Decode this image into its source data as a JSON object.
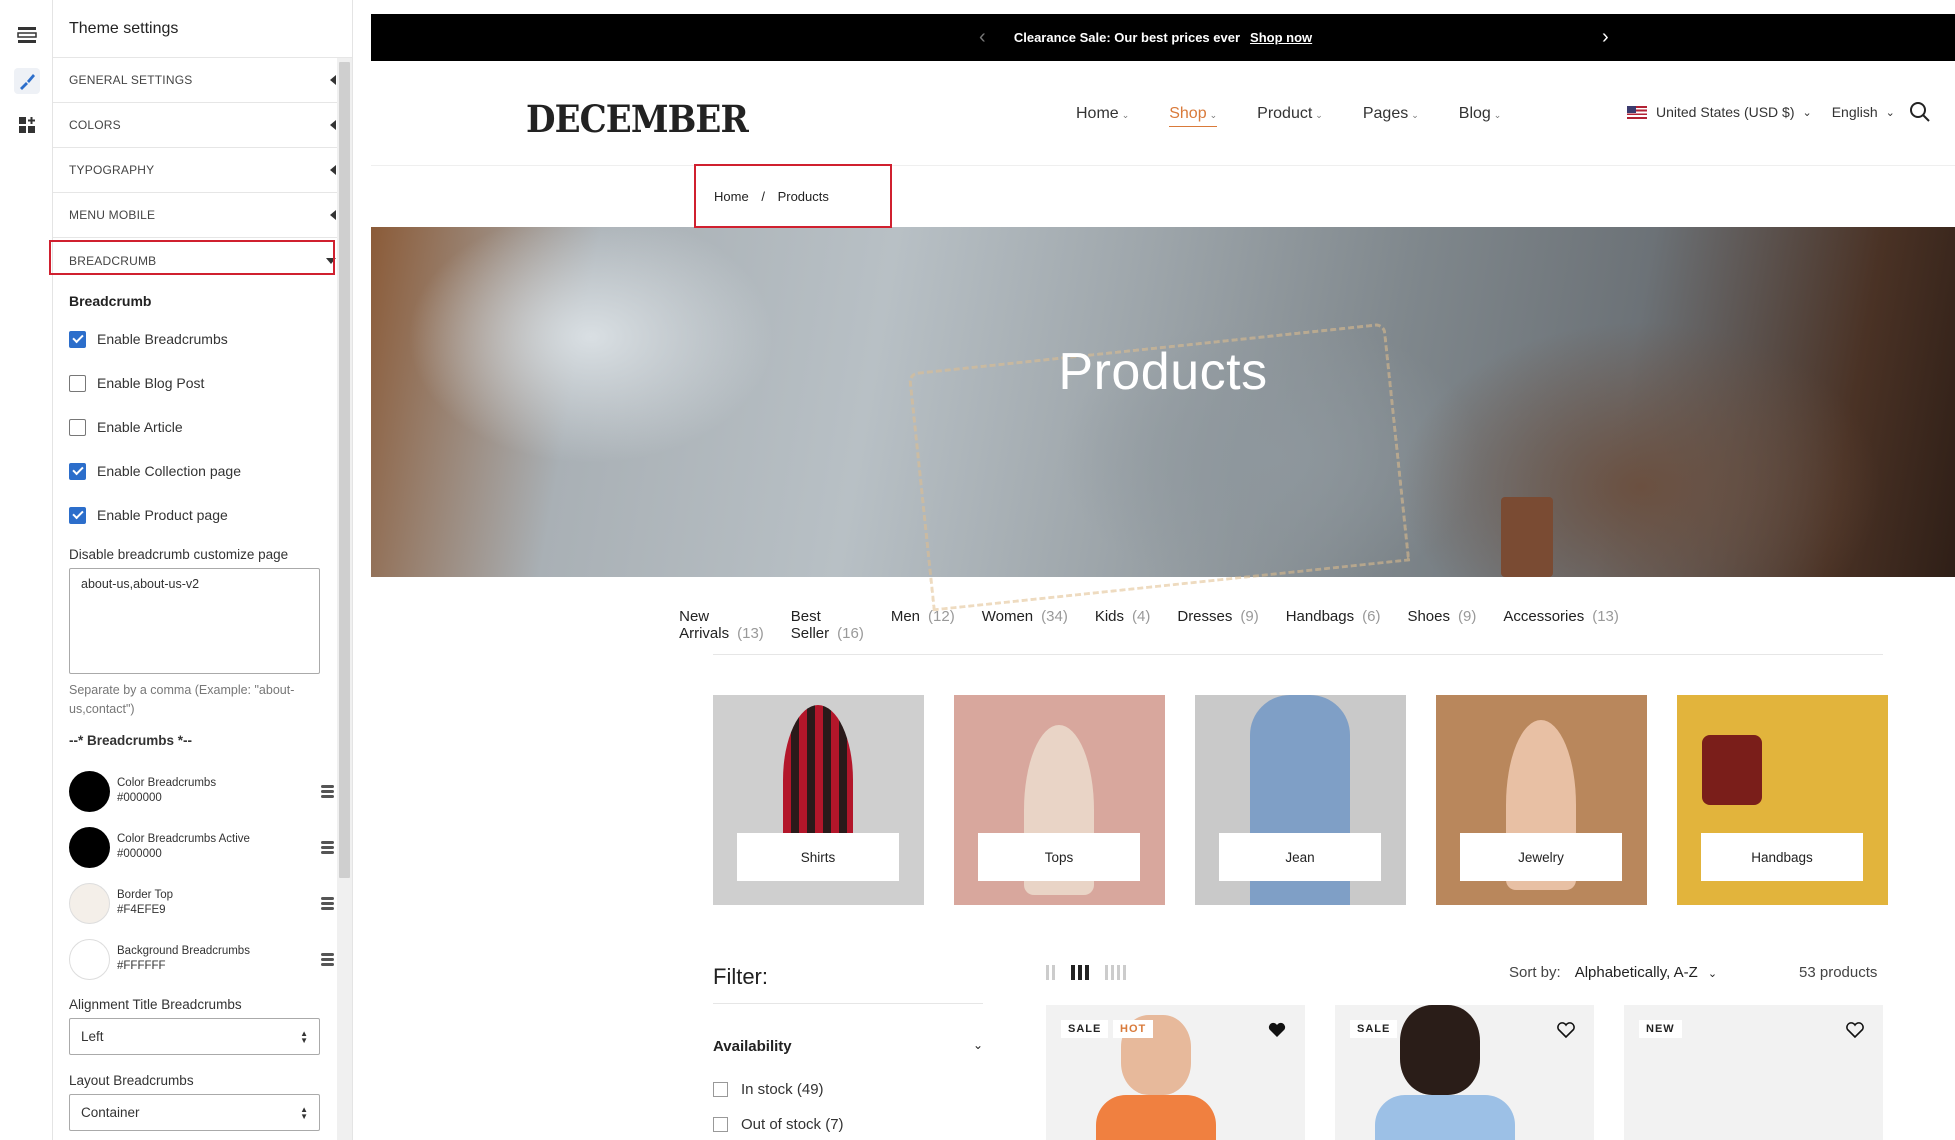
{
  "panel": {
    "title": "Theme settings",
    "sections": [
      "GENERAL SETTINGS",
      "COLORS",
      "TYPOGRAPHY",
      "MENU MOBILE",
      "BREADCRUMB"
    ],
    "subtitle": "Breadcrumb",
    "checkboxes": [
      {
        "label": "Enable Breadcrumbs",
        "checked": true
      },
      {
        "label": "Enable Blog Post",
        "checked": false
      },
      {
        "label": "Enable Article",
        "checked": false
      },
      {
        "label": "Enable Collection page",
        "checked": true
      },
      {
        "label": "Enable Product page",
        "checked": true
      }
    ],
    "disable_label": "Disable breadcrumb customize page",
    "disable_value": "about-us,about-us-v2",
    "help": "Separate by a comma (Example: \"about-us,contact\")",
    "group": "--* Breadcrumbs *--",
    "colors": [
      {
        "name": "Color Breadcrumbs",
        "hex": "#000000"
      },
      {
        "name": "Color Breadcrumbs Active",
        "hex": "#000000"
      },
      {
        "name": "Border Top",
        "hex": "#F4EFE9"
      },
      {
        "name": "Background Breadcrumbs",
        "hex": "#FFFFFF"
      }
    ],
    "align_label": "Alignment Title Breadcrumbs",
    "align_value": "Left",
    "layout_label": "Layout Breadcrumbs",
    "layout_value": "Container"
  },
  "site": {
    "announcement": "Clearance Sale: Our best prices ever",
    "announcement_link": "Shop now",
    "logo": "DECEMBER",
    "nav": [
      "Home",
      "Shop",
      "Product",
      "Pages",
      "Blog"
    ],
    "nav_active": "Shop",
    "currency": "United States (USD $)",
    "language": "English",
    "breadcrumb": {
      "home": "Home",
      "sep": "/",
      "current": "Products"
    },
    "hero_title": "Products",
    "categories": [
      {
        "name": "New Arrivals",
        "count": "(13)"
      },
      {
        "name": "Best Seller",
        "count": "(16)"
      },
      {
        "name": "Men",
        "count": "(12)"
      },
      {
        "name": "Women",
        "count": "(34)"
      },
      {
        "name": "Kids",
        "count": "(4)"
      },
      {
        "name": "Dresses",
        "count": "(9)"
      },
      {
        "name": "Handbags",
        "count": "(6)"
      },
      {
        "name": "Shoes",
        "count": "(9)"
      },
      {
        "name": "Accessories",
        "count": "(13)"
      }
    ],
    "tiles": [
      "Shirts",
      "Tops",
      "Jean",
      "Jewelry",
      "Handbags"
    ],
    "filter": "Filter:",
    "availability": "Availability",
    "in_stock": "In stock (49)",
    "out_stock": "Out of stock (7)",
    "sort_label": "Sort by:",
    "sort_value": "Alphabetically, A-Z",
    "product_count": "53 products",
    "badges": {
      "sale": "SALE",
      "hot": "HOT",
      "new": "NEW"
    },
    "colors": {
      "accent": "#d97a3a",
      "highlight": "#d0202f",
      "checkbox": "#2c6ecb"
    }
  }
}
